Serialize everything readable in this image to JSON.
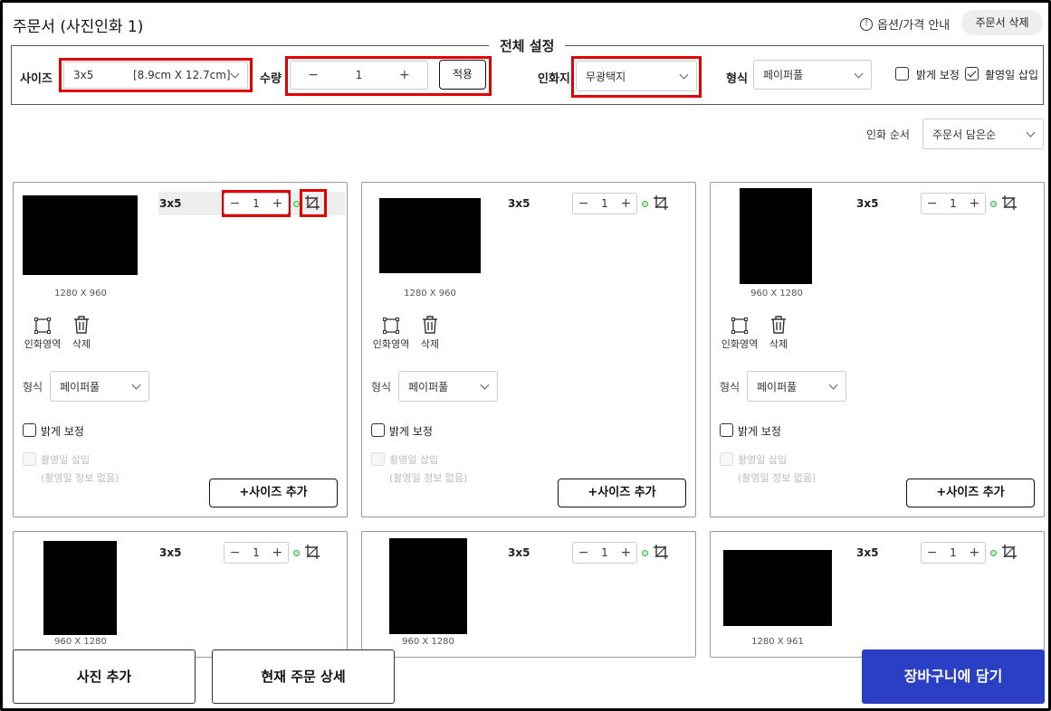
{
  "header": {
    "title": "주문서 (사진인화 1)",
    "help_label": "옵션/가격 안내",
    "delete_order_label": "주문서 삭제"
  },
  "global": {
    "title": "전체 설정",
    "size_label": "사이즈",
    "size_value": "3x5",
    "size_detail": "[8.9cm X 12.7cm]",
    "qty_label": "수량",
    "qty_minus": "−",
    "qty_value": "1",
    "qty_plus": "+",
    "apply_label": "적용",
    "paper_label": "인화지",
    "paper_value": "무광택지",
    "format_label": "형식",
    "format_value": "페이퍼풀",
    "brighten_label": "밝게 보정",
    "brighten_checked": false,
    "date_label": "촬영일 삽입",
    "date_checked": true
  },
  "sort": {
    "label": "인화 순서",
    "value": "주문서 담은순"
  },
  "cards": [
    {
      "size": "3x5",
      "qty": "1",
      "resolution": "1280 X 960",
      "orientation": "landscape",
      "highlighted": true,
      "crop_label": "인화영역",
      "delete_label": "삭제",
      "format_label": "형식",
      "format_value": "페이퍼풀",
      "brighten_label": "밝게 보정",
      "date_label": "촬영일 삽입",
      "date_note": "(촬영일 정보 없음)",
      "add_size_label": "+사이즈 추가"
    },
    {
      "size": "3x5",
      "qty": "1",
      "resolution": "1280 X 960",
      "orientation": "landscape",
      "highlighted": false,
      "crop_label": "인화영역",
      "delete_label": "삭제",
      "format_label": "형식",
      "format_value": "페이퍼풀",
      "brighten_label": "밝게 보정",
      "date_label": "촬영일 삽입",
      "date_note": "(촬영일 정보 없음)",
      "add_size_label": "+사이즈 추가"
    },
    {
      "size": "3x5",
      "qty": "1",
      "resolution": "960 X 1280",
      "orientation": "portrait",
      "highlighted": false,
      "crop_label": "인화영역",
      "delete_label": "삭제",
      "format_label": "형식",
      "format_value": "페이퍼풀",
      "brighten_label": "밝게 보정",
      "date_label": "촬영일 삽입",
      "date_note": "(촬영일 정보 없음)",
      "add_size_label": "+사이즈 추가"
    },
    {
      "size": "3x5",
      "qty": "1",
      "resolution": "960 X 1280",
      "orientation": "portrait",
      "highlighted": false
    },
    {
      "size": "3x5",
      "qty": "1",
      "resolution": "960 X 1280",
      "orientation": "portrait",
      "highlighted": false
    },
    {
      "size": "3x5",
      "qty": "1",
      "resolution": "1280 X 961",
      "orientation": "landscape",
      "highlighted": false
    }
  ],
  "footer": {
    "add_photo_label": "사진 추가",
    "order_detail_label": "현재 주문 상세",
    "cart_label": "장바구니에 담기",
    "cart_color": "#2b3fc4"
  },
  "icons": [
    "info-icon",
    "chevron-down-icon",
    "crop-icon",
    "trash-icon",
    "check-icon",
    "status-dot-icon"
  ]
}
